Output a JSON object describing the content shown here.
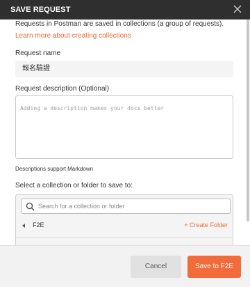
{
  "dialog": {
    "title": "SAVE REQUEST",
    "close_icon": "close-icon"
  },
  "intro": {
    "text": "Requests in Postman are saved in collections (a group of requests).",
    "link": "Learn more about creating collections"
  },
  "request_name": {
    "label": "Request name",
    "value": "報名驗證"
  },
  "request_description": {
    "label": "Request description (Optional)",
    "placeholder": "Adding a description makes your docs better"
  },
  "markdown_hint": "Descriptions support Markdown",
  "collection_picker": {
    "label": "Select a collection or folder to save to:",
    "search_placeholder": "Search for a collection or folder",
    "search_icon": "search-icon",
    "breadcrumb": "F2E",
    "back_icon": "chevron-left-icon",
    "create_folder": "+ Create Folder"
  },
  "footer": {
    "cancel_label": "Cancel",
    "save_label": "Save to F2E"
  },
  "colors": {
    "accent": "#f26b3a",
    "titlebar": "#2f2f2f"
  }
}
